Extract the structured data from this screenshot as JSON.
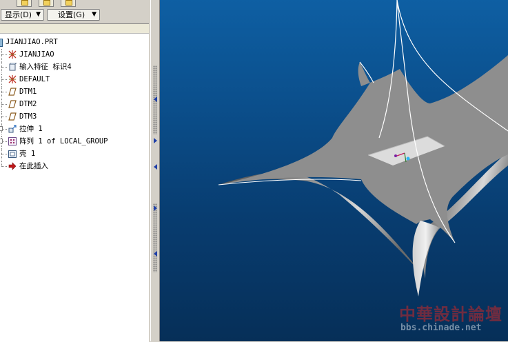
{
  "menubar": {
    "display_label": "显示(D)",
    "settings_label": "设置(G)"
  },
  "tree": {
    "root": "JIANJIAO.PRT",
    "items": [
      {
        "label": "JIANJIAO",
        "icon": "csys-icon"
      },
      {
        "label": "输入特征 标识4",
        "icon": "import-feature-icon"
      },
      {
        "label": "DEFAULT",
        "icon": "csys-icon"
      },
      {
        "label": "DTM1",
        "icon": "datum-plane-icon"
      },
      {
        "label": "DTM2",
        "icon": "datum-plane-icon"
      },
      {
        "label": "DTM3",
        "icon": "datum-plane-icon"
      },
      {
        "label": "拉伸 1",
        "icon": "extrude-icon"
      },
      {
        "label": "阵列 1 of LOCAL_GROUP",
        "icon": "pattern-icon"
      },
      {
        "label": "壳 1",
        "icon": "shell-icon"
      },
      {
        "label": "在此插入",
        "icon": "insert-here-arrow-icon"
      }
    ]
  },
  "viewport": {
    "background_top": "#0e5fa3",
    "background_bottom": "#062f58"
  },
  "watermark": {
    "title": "中華設計論壇",
    "url": "bbs.chinade.net"
  }
}
